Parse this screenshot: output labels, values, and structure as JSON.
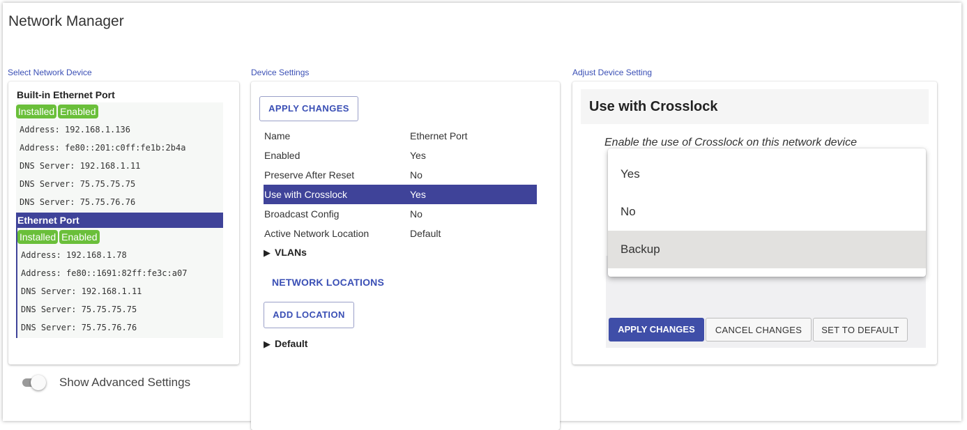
{
  "app": {
    "title": "Network Manager"
  },
  "columns": {
    "left_label": "Select Network Device",
    "middle_label": "Device Settings",
    "right_label": "Adjust Device Setting"
  },
  "devices": [
    {
      "name": "Built-in Ethernet Port",
      "badges": [
        "Installed",
        "Enabled"
      ],
      "details": [
        "Address: 192.168.1.136",
        "Address: fe80::201:c0ff:fe1b:2b4a",
        "DNS Server: 192.168.1.11",
        "DNS Server: 75.75.75.75",
        "DNS Server: 75.75.76.76"
      ]
    },
    {
      "name": "Ethernet Port",
      "badges": [
        "Installed",
        "Enabled"
      ],
      "details": [
        "Address: 192.168.1.78",
        "Address: fe80::1691:82ff:fe3c:a07",
        "DNS Server: 192.168.1.11",
        "DNS Server: 75.75.75.75",
        "DNS Server: 75.75.76.76"
      ]
    }
  ],
  "advanced_toggle": {
    "label": "Show Advanced Settings",
    "on": false
  },
  "device_settings": {
    "apply_label": "APPLY CHANGES",
    "rows": [
      {
        "key": "Name",
        "value": "Ethernet Port"
      },
      {
        "key": "Enabled",
        "value": "Yes"
      },
      {
        "key": "Preserve After Reset",
        "value": "No"
      },
      {
        "key": "Use with Crosslock",
        "value": "Yes"
      },
      {
        "key": "Broadcast Config",
        "value": "No"
      },
      {
        "key": "Active Network Location",
        "value": "Default"
      }
    ],
    "vlans_label": "VLANs",
    "network_locations_title": "NETWORK LOCATIONS",
    "add_location_label": "ADD LOCATION",
    "default_location_label": "Default"
  },
  "adjust_setting": {
    "title": "Use with Crosslock",
    "description": "Enable the use of Crosslock on this network device",
    "options": [
      "Yes",
      "No",
      "Backup"
    ],
    "highlighted_option": "Backup",
    "apply_label": "APPLY CHANGES",
    "cancel_label": "CANCEL CHANGES",
    "default_label": "SET TO DEFAULT"
  },
  "colors": {
    "accent": "#3f4399",
    "link_blue": "#3a4fb5",
    "badge_green": "#6abf3a"
  }
}
